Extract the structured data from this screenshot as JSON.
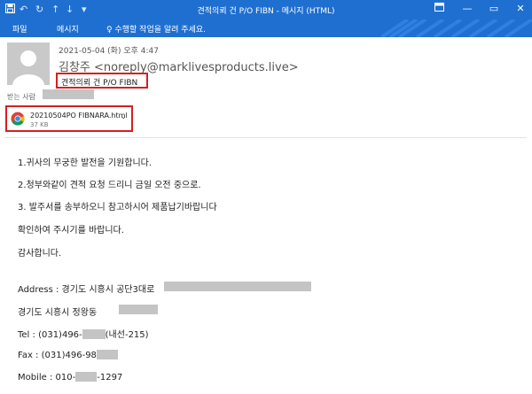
{
  "titlebar": {
    "title": "견적의뢰 건 P/O FIBN - 메시지 (HTML)",
    "accent": "#1f6fd1"
  },
  "ribbon": {
    "tab_file": "파일",
    "tab_message": "메시지",
    "tell_me": "수행할 작업을 알려 주세요."
  },
  "email": {
    "date": "2021-05-04 (화) 오후 4:47",
    "sender": "김창주 <noreply@marklivesproducts.live>",
    "subject": "견적의뢰 건 P/O FIBN",
    "to_label": "받는 사람"
  },
  "attachment": {
    "name": "20210504PO FIBNARA.html",
    "size": "37 KB",
    "icon": "chrome-icon"
  },
  "body": {
    "line1": "1.귀사의 무궁한 발전을 기원합니다.",
    "line2": "2.청부와같이 견적 요청 드리니 금일 오전 중으로.",
    "line3": "3. 발주서를 송부하오니 참고하시어 제품납기바랍니다",
    "line4": "확인하여 주시기를 바랍니다.",
    "line5": "감사합니다.",
    "address_label": "Address : 경기도 시흥시 공단3대로",
    "address2": "경기도 시흥시 정왕동",
    "tel_prefix": "Tel : (031)496-",
    "tel_suffix": "(내선-215)",
    "fax_prefix": "Fax : (031)496-98",
    "mobile_prefix": "Mobile : 010-",
    "mobile_suffix": "-1297"
  }
}
